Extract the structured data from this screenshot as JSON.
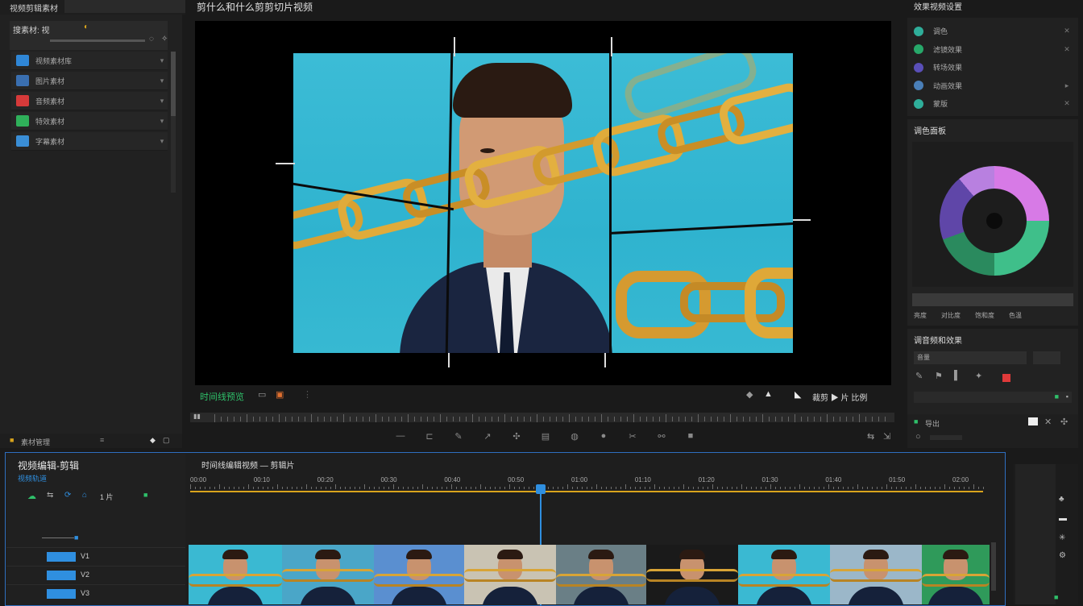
{
  "app": {
    "panel_title": "视频剪辑素材",
    "viewer_title": "剪什么和什么剪剪切片视频"
  },
  "left_panel": {
    "search_label": "搜素材: 视",
    "items": [
      {
        "label": "视频素材库",
        "color": "#2f86d6"
      },
      {
        "label": "图片素材",
        "color": "#3a6fb0"
      },
      {
        "label": "音频素材",
        "color": "#d63a3a"
      },
      {
        "label": "特效素材",
        "color": "#2fb05a"
      },
      {
        "label": "字幕素材",
        "color": "#3a8ed6"
      }
    ],
    "footer_label": "素材管理"
  },
  "viewer": {
    "mode_label": "时间线预览",
    "controls_right": "裁剪 ▶ 片 比例"
  },
  "right_panel": {
    "title": "效果视频设置",
    "effects": [
      {
        "label": "调色",
        "color": "#2fae9a"
      },
      {
        "label": "滤镜效果",
        "color": "#27a86a"
      },
      {
        "label": "转场效果",
        "color": "#5a4fb8"
      },
      {
        "label": "动画效果",
        "color": "#4a7fb8"
      },
      {
        "label": "蒙版",
        "color": "#2fae9a"
      }
    ],
    "color_section_title": "调色面板",
    "color_readout": [
      "亮度",
      "对比度",
      "饱和度",
      "色温"
    ],
    "audio_section_title": "调音频和效果",
    "audio_field": "音量",
    "bottom_label": "导出"
  },
  "timeline": {
    "title": "视频编辑-剪辑",
    "subtitle": "时间线编辑视频 — 剪辑片",
    "track_label": "视频轨道",
    "counter": "1 片",
    "tracks": [
      "V1",
      "V2",
      "V3"
    ],
    "ruler_labels": [
      "00:00",
      "00:10",
      "00:20",
      "00:30",
      "00:40",
      "00:50",
      "01:00",
      "01:10",
      "01:20",
      "01:30",
      "01:40",
      "01:50",
      "02:00"
    ],
    "playhead_fraction": 0.44
  },
  "colors": {
    "accent_blue": "#2f8fe0",
    "accent_green": "#2fc06a",
    "timeline_gold": "#d9a41c",
    "cyan_bg": "#3fbfd6"
  }
}
